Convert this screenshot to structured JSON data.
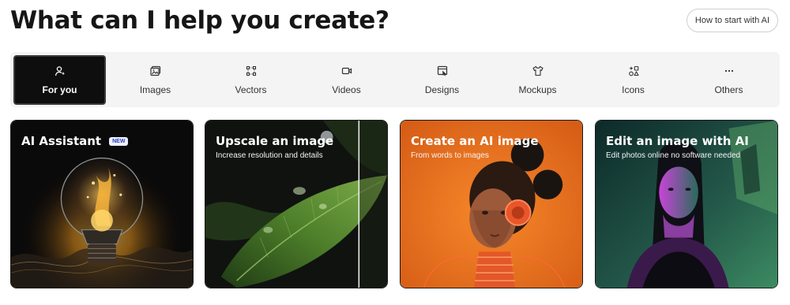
{
  "header": {
    "title": "What can I help you create?",
    "how_to_button": "How to start with AI"
  },
  "tabs": [
    {
      "label": "For you",
      "icon": "person-sparkle-icon",
      "active": true
    },
    {
      "label": "Images",
      "icon": "image-icon",
      "active": false
    },
    {
      "label": "Vectors",
      "icon": "vector-icon",
      "active": false
    },
    {
      "label": "Videos",
      "icon": "video-icon",
      "active": false
    },
    {
      "label": "Designs",
      "icon": "design-icon",
      "active": false
    },
    {
      "label": "Mockups",
      "icon": "tshirt-icon",
      "active": false
    },
    {
      "label": "Icons",
      "icon": "icons-icon",
      "active": false
    },
    {
      "label": "Others",
      "icon": "more-icon",
      "active": false
    }
  ],
  "cards": [
    {
      "title": "AI Assistant",
      "badge": "NEW",
      "subtitle": ""
    },
    {
      "title": "Upscale an image",
      "subtitle": "Increase resolution and details"
    },
    {
      "title": "Create an AI image",
      "subtitle": "From words to images"
    },
    {
      "title": "Edit an image with AI",
      "subtitle": "Edit photos online no software needed"
    }
  ],
  "colors": {
    "active_tab_bg": "#0e0e0e",
    "tab_bar_bg": "#f4f4f4",
    "badge_text": "#2b3fbf"
  }
}
